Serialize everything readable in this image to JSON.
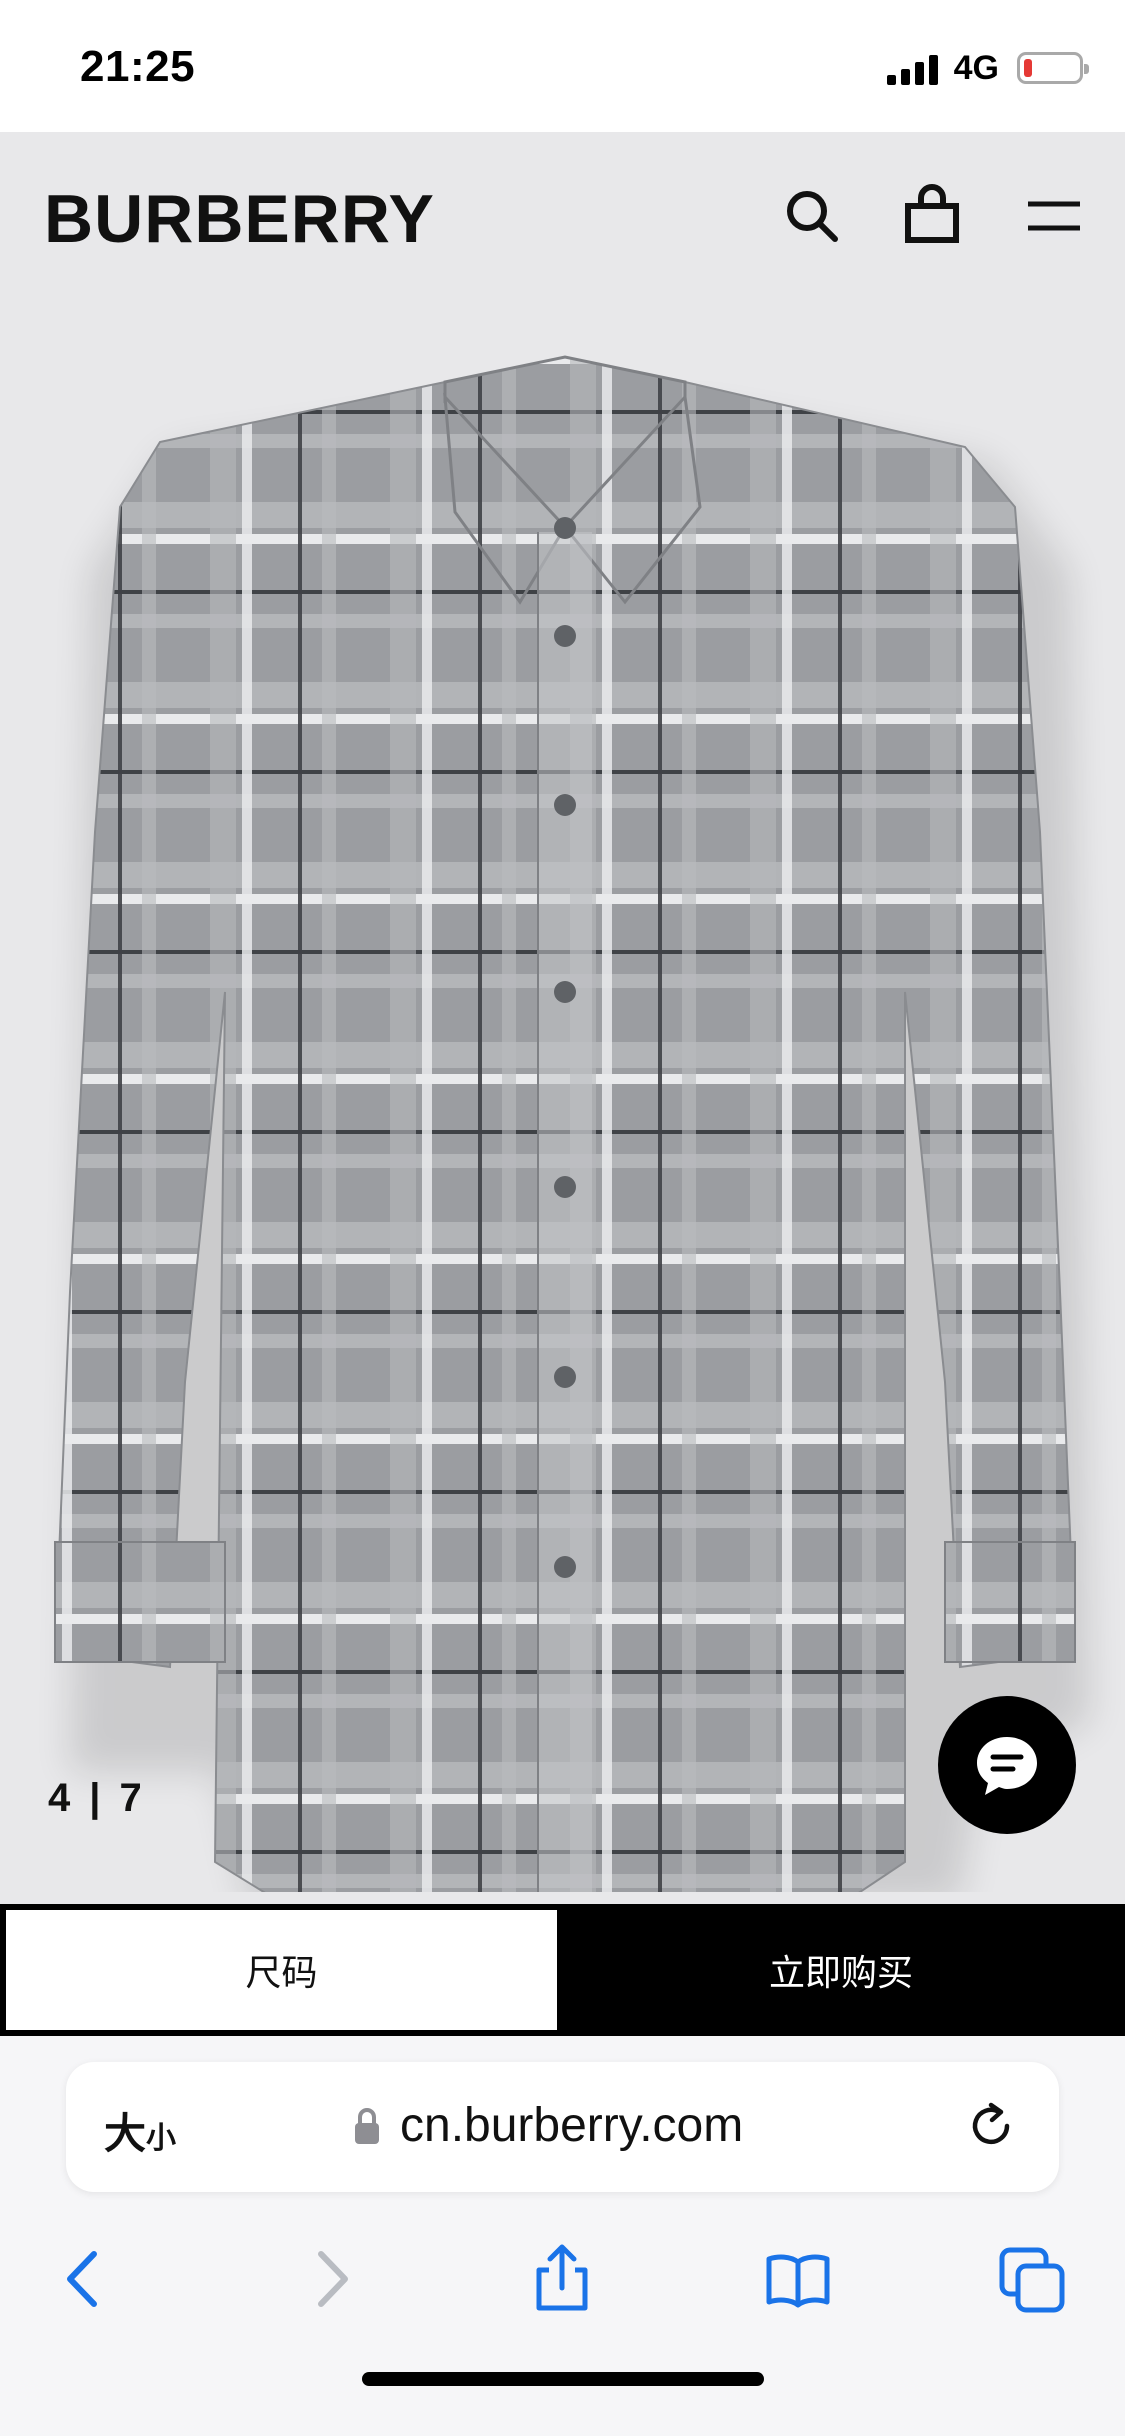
{
  "status_bar": {
    "time": "21:25",
    "network": "4G",
    "battery_level": 0.1
  },
  "header": {
    "logo": "BURBERRY",
    "icons": [
      "search-icon",
      "shopping-bag-icon",
      "menu-icon"
    ]
  },
  "product": {
    "image": "grey check shirt",
    "counter": {
      "current": "4",
      "separator": "|",
      "total": "7"
    }
  },
  "actions": {
    "size_label": "尺码",
    "buy_label": "立即购买"
  },
  "browser": {
    "text_size_label": "大",
    "text_size_small": "小",
    "url": "cn.burberry.com",
    "toolbar_icons": [
      "back-icon",
      "forward-icon",
      "share-icon",
      "bookmarks-icon",
      "tabs-icon"
    ]
  },
  "colors": {
    "accent": "#000000",
    "product_bg": "#e8e8ea",
    "shirt": "#9a9ca0",
    "link_blue": "#1a73e8"
  }
}
